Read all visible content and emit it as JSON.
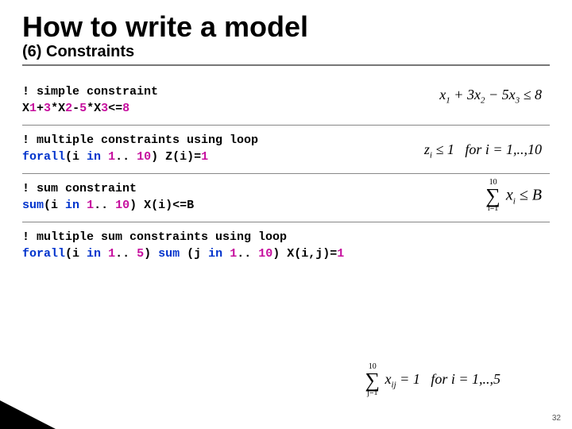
{
  "title": "How to write a model",
  "subtitle": "(6) Constraints",
  "blocks": [
    {
      "comment": "! simple constraint",
      "code_html": "X1+3*X2-5*X3<=8",
      "code_parts": [
        "X",
        "1",
        "+",
        "3",
        "*X",
        "2",
        "-",
        "5",
        "*X",
        "3",
        "<=",
        "8"
      ],
      "math": "x₁ + 3x₂ − 5x₃ ≤ 8"
    },
    {
      "comment": "! multiple constraints using loop",
      "code_prefix": "forall",
      "code_mid": "(i ",
      "code_in": "in",
      "code_range": " 1.. 10) Z(i)=1",
      "math": "zᵢ ≤ 1   for i = 1,..,10"
    },
    {
      "comment": "! sum constraint",
      "code_prefix": "sum",
      "code_mid": "(i ",
      "code_in": "in",
      "code_range": " 1.. 10) X(i)<=B",
      "math_sigma_top": "10",
      "math_sigma_bot": "i=1",
      "math_body": "xᵢ ≤ B"
    },
    {
      "comment": "! multiple sum constraints using loop",
      "code_full": "forall(i in 1.. 5) sum (j in 1.. 10) X(i,j)=1",
      "math_sigma_top": "10",
      "math_sigma_bot": "j=1",
      "math_body": "xᵢⱼ = 1   for i = 1,..,5"
    }
  ],
  "pagenum": "32"
}
